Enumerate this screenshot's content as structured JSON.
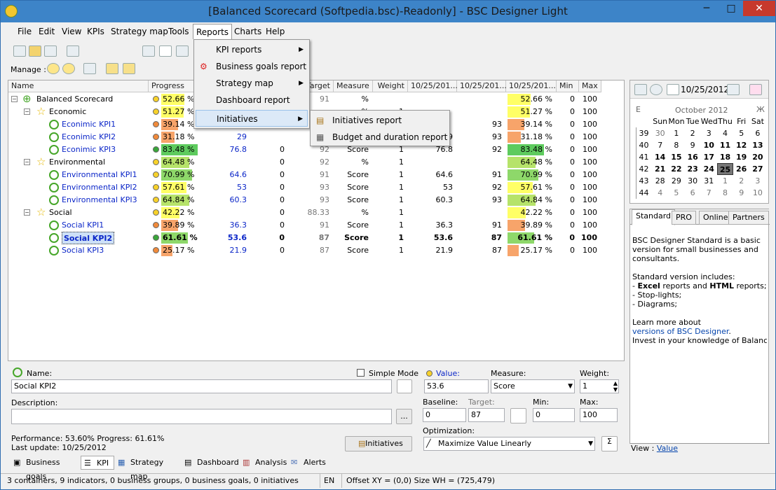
{
  "window": {
    "title": "[Balanced Scorecard (Softpedia.bsc)-Readonly] - BSC Designer Light",
    "minimize": "─",
    "maximize": "□",
    "close": "✕"
  },
  "menu": [
    "File",
    "Edit",
    "View",
    "KPIs",
    "Strategy map",
    "Tools",
    "Reports",
    "Charts",
    "Help"
  ],
  "toolbar": {
    "manage_label": "Manage :"
  },
  "grid": {
    "headers": [
      "Name",
      "Progress",
      "",
      "",
      "Target",
      "Measure",
      "Weight",
      "10/25/201...",
      "10/25/201...",
      "10/25/201...",
      "Min",
      "Max"
    ],
    "rows": [
      {
        "name": "Balanced Scorecard",
        "level": 0,
        "type": "root",
        "progress": "52.66",
        "prog_unit": " %",
        "prog_color": "#ffff66",
        "dot": "#f7d12a",
        "value": "",
        "baseline": "",
        "target": "91",
        "measure": "%",
        "weight": "",
        "c1": "",
        "c2": "",
        "c3": "52.66 %",
        "c3_color": "#ffff66",
        "min": "0",
        "max": "100",
        "bold": false
      },
      {
        "name": "Economic",
        "level": 1,
        "type": "group",
        "progress": "51.27",
        "prog_unit": " %",
        "prog_color": "#ffff66",
        "dot": "#f7d12a",
        "value": "",
        "baseline": "",
        "target": "",
        "measure": "%",
        "weight": "1",
        "c1": "",
        "c2": "",
        "c3": "51.27 %",
        "c3_color": "#ffff66",
        "min": "0",
        "max": "100",
        "bold": false
      },
      {
        "name": "Econimic KPI1",
        "level": 2,
        "type": "kpi",
        "progress": "39.",
        "prog_unit": "14 %",
        "prog_color": "#f7a46a",
        "dot": "#f08a3a",
        "value": "",
        "baseline": "",
        "target": "",
        "measure": "",
        "weight": "",
        "c1": "",
        "c2": "93",
        "c3": "39.14 %",
        "c3_color": "#f7a46a",
        "min": "0",
        "max": "100",
        "bold": false
      },
      {
        "name": "Econimic KPI2",
        "level": 2,
        "type": "kpi",
        "progress": "31.",
        "prog_unit": "18 %",
        "prog_color": "#f7a46a",
        "dot": "#f08a3a",
        "value": "29",
        "baseline": "",
        "target": "",
        "measure": "",
        "weight": "",
        "c1": "9",
        "c2": "93",
        "c3": "31.18 %",
        "c3_color": "#f7a46a",
        "min": "0",
        "max": "100",
        "bold": false
      },
      {
        "name": "Econimic KPI3",
        "level": 2,
        "type": "kpi",
        "progress": "83.48",
        "prog_unit": " %",
        "prog_color": "#5ecb5e",
        "dot": "#3aa63a",
        "value": "76.8",
        "baseline": "0",
        "target": "92",
        "measure": "Score",
        "weight": "1",
        "c1": "76.8",
        "c2": "92",
        "c3": "83.48 %",
        "c3_color": "#5ecb5e",
        "min": "0",
        "max": "100",
        "bold": false
      },
      {
        "name": "Environmental",
        "level": 1,
        "type": "group",
        "progress": "64.48",
        "prog_unit": " %",
        "prog_color": "#b6e36a",
        "dot": "#f7d12a",
        "value": "",
        "baseline": "0",
        "target": "92",
        "measure": "%",
        "weight": "1",
        "c1": "",
        "c2": "",
        "c3": "64.48 %",
        "c3_color": "#b6e36a",
        "min": "0",
        "max": "100",
        "bold": false
      },
      {
        "name": "Environmental KPI1",
        "level": 2,
        "type": "kpi",
        "progress": "70.99",
        "prog_unit": " %",
        "prog_color": "#8ed86a",
        "dot": "#f7d12a",
        "value": "64.6",
        "baseline": "0",
        "target": "91",
        "measure": "Score",
        "weight": "1",
        "c1": "64.6",
        "c2": "91",
        "c3": "70.99 %",
        "c3_color": "#8ed86a",
        "min": "0",
        "max": "100",
        "bold": false
      },
      {
        "name": "Environmental KPI2",
        "level": 2,
        "type": "kpi",
        "progress": "57.61",
        "prog_unit": " %",
        "prog_color": "#ffff66",
        "dot": "#f7d12a",
        "value": "53",
        "baseline": "0",
        "target": "93",
        "measure": "Score",
        "weight": "1",
        "c1": "53",
        "c2": "92",
        "c3": "57.61 %",
        "c3_color": "#ffff66",
        "min": "0",
        "max": "100",
        "bold": false
      },
      {
        "name": "Environmental KPI3",
        "level": 2,
        "type": "kpi",
        "progress": "64.84",
        "prog_unit": " %",
        "prog_color": "#b6e36a",
        "dot": "#f7d12a",
        "value": "60.3",
        "baseline": "0",
        "target": "93",
        "measure": "Score",
        "weight": "1",
        "c1": "60.3",
        "c2": "93",
        "c3": "64.84 %",
        "c3_color": "#b6e36a",
        "min": "0",
        "max": "100",
        "bold": false
      },
      {
        "name": "Social",
        "level": 1,
        "type": "group",
        "progress": "42.22",
        "prog_unit": " %",
        "prog_color": "#ffff66",
        "dot": "#f7d12a",
        "value": "",
        "baseline": "0",
        "target": "88.33",
        "measure": "%",
        "weight": "1",
        "c1": "",
        "c2": "",
        "c3": "42.22 %",
        "c3_color": "#ffff66",
        "min": "0",
        "max": "100",
        "bold": false
      },
      {
        "name": "Social KPI1",
        "level": 2,
        "type": "kpi",
        "progress": "39.",
        "prog_unit": "89 %",
        "prog_color": "#f7a46a",
        "dot": "#f08a3a",
        "value": "36.3",
        "baseline": "0",
        "target": "91",
        "measure": "Score",
        "weight": "1",
        "c1": "36.3",
        "c2": "91",
        "c3": "39.89 %",
        "c3_color": "#f7a46a",
        "min": "0",
        "max": "100",
        "bold": false
      },
      {
        "name": "Social KPI2",
        "level": 2,
        "type": "kpi",
        "progress": "61.61",
        "prog_unit": " %",
        "prog_color": "#8ed86a",
        "dot": "#3aa63a",
        "value": "53.6",
        "baseline": "0",
        "target": "87",
        "measure": "Score",
        "weight": "1",
        "c1": "53.6",
        "c2": "87",
        "c3": "61.61 %",
        "c3_color": "#8ed86a",
        "min": "0",
        "max": "100",
        "bold": true
      },
      {
        "name": "Social KPI3",
        "level": 2,
        "type": "kpi",
        "progress": "25.",
        "prog_unit": "17 %",
        "prog_color": "#f7a46a",
        "dot": "#f08a3a",
        "value": "21.9",
        "baseline": "0",
        "target": "87",
        "measure": "Score",
        "weight": "1",
        "c1": "21.9",
        "c2": "87",
        "c3": "25.17 %",
        "c3_color": "#f7a46a",
        "min": "0",
        "max": "100",
        "bold": false
      }
    ]
  },
  "reports_menu": {
    "items": [
      "KPI reports",
      "Business goals report",
      "Strategy map",
      "Dashboard report",
      "Initiatives"
    ],
    "submenu": [
      "Initiatives report",
      "Budget and duration report"
    ]
  },
  "calendar": {
    "date": "10/25/2012",
    "month": "October 2012",
    "prev": "Ε",
    "next": "Ж",
    "weekdays": [
      "Sun",
      "Mon",
      "Tue",
      "Wed",
      "Thu",
      "Fri",
      "Sat"
    ],
    "weeks": [
      {
        "wk": "39",
        "days": [
          "30",
          "1",
          "2",
          "3",
          "4",
          "5",
          "6"
        ]
      },
      {
        "wk": "40",
        "days": [
          "7",
          "8",
          "9",
          "10",
          "11",
          "12",
          "13"
        ]
      },
      {
        "wk": "41",
        "days": [
          "14",
          "15",
          "16",
          "17",
          "18",
          "19",
          "20"
        ]
      },
      {
        "wk": "42",
        "days": [
          "21",
          "22",
          "23",
          "24",
          "25",
          "26",
          "27"
        ]
      },
      {
        "wk": "43",
        "days": [
          "28",
          "29",
          "30",
          "31",
          "1",
          "2",
          "3"
        ]
      },
      {
        "wk": "44",
        "days": [
          "4",
          "5",
          "6",
          "7",
          "8",
          "9",
          "10"
        ]
      }
    ]
  },
  "side": {
    "tabs": [
      "Standard",
      "PRO",
      "Online",
      "Partners"
    ],
    "p1": "BSC Designer Standard is a basic version for small businesses and consultants.",
    "p2": "Standard version includes:",
    "b1a": " - ",
    "b1b": "Excel",
    "b1c": " reports and ",
    "b1d": "HTML",
    "b1e": " reports;",
    "b2": " - Stop-lights;",
    "b3": " - Diagrams;",
    "p3": "Learn more about",
    "link": "versions of BSC Designer",
    "p3b": ".",
    "p4": "Invest in your knowledge of Balanced Sc",
    "view_label": "View : ",
    "view_link": "Value"
  },
  "form": {
    "name_label": "Name:",
    "name_value": "Social KPI2",
    "simple_mode": "Simple Mode",
    "description_label": "Description:",
    "value_label": "Value:",
    "value_value": "53.6",
    "measure_label": "Measure:",
    "measure_value": "Score",
    "weight_label": "Weight:",
    "weight_value": "1",
    "baseline_label": "Baseline:",
    "baseline_value": "0",
    "target_label": "Target:",
    "target_value": "87",
    "min_label": "Min:",
    "min_value": "0",
    "max_label": "Max:",
    "max_value": "100",
    "optimization_label": "Optimization:",
    "optimization_value": "Maximize Value Linearly",
    "performance": "Performance: 53.60%  Progress: 61.61%",
    "last_update": "Last update: 10/25/2012",
    "initiatives_btn": "Initiatives",
    "ellipsis": "..."
  },
  "bottom_tabs": [
    "Business goals",
    "KPI",
    "Strategy map",
    "Dashboard",
    "Analysis",
    "Alerts"
  ],
  "status": {
    "left": "3 containers, 9 indicators, 0 business groups, 0 business goals, 0 initiatives",
    "lang": "EN",
    "offset": "Offset XY = (0,0) Size WH = (725,479)"
  }
}
